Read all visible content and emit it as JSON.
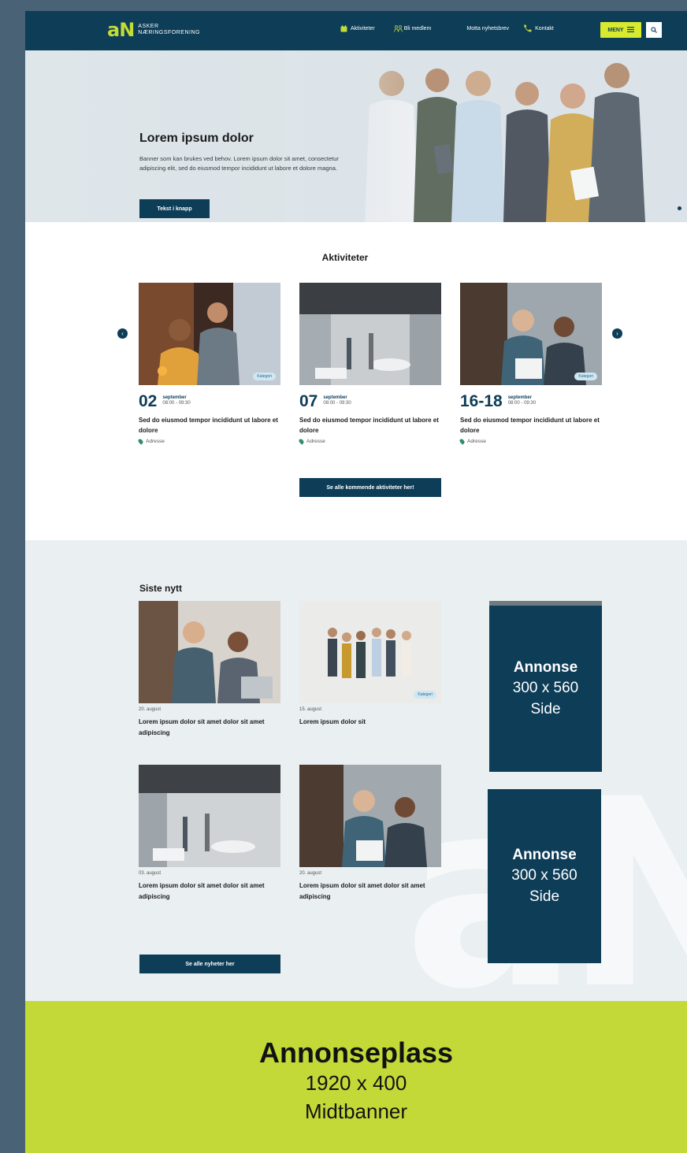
{
  "header": {
    "logo_mark": "aN",
    "logo_line1": "ASKER",
    "logo_line2": "NÆRINGSFORENING",
    "nav": [
      {
        "label": "Aktiviteter",
        "icon": "calendar-icon"
      },
      {
        "label": "Bli medlem",
        "icon": "people-icon"
      },
      {
        "label": "Motta nyhetsbrev",
        "icon": "mail-icon"
      },
      {
        "label": "Kontakt",
        "icon": "phone-icon"
      }
    ],
    "menu_label": "MENY",
    "colors": {
      "bar": "#0d3d57",
      "accent": "#d7ea2d"
    }
  },
  "hero": {
    "title": "Lorem ipsum dolor",
    "text": "Banner som kan brukes ved behov. Lorem ipsum dolor sit amet, consectetur adipiscing elit, sed do eiusmod tempor incididunt ut labore et dolore magna.",
    "button_label": "Tekst i knapp"
  },
  "activities": {
    "title": "Aktiviteter",
    "cards": [
      {
        "day": "02",
        "month": "september",
        "time": "08:00 - 09:30",
        "title": "Sed do eiusmod tempor incididunt ut labore et dolore",
        "address": "Adresse",
        "tag": "Kategori"
      },
      {
        "day": "07",
        "month": "september",
        "time": "08:00 - 09:30",
        "title": "Sed do eiusmod tempor incididunt ut labore et dolore",
        "address": "Adresse",
        "tag": ""
      },
      {
        "day": "16-18",
        "month": "september",
        "time": "08:00 - 09:30",
        "title": "Sed do eiusmod tempor incididunt ut labore et dolore",
        "address": "Adresse",
        "tag": "Kategori"
      }
    ],
    "all_button": "Se alle kommende aktiviteter her!"
  },
  "news": {
    "title": "Siste nytt",
    "items": [
      {
        "date": "20. august",
        "title": "Lorem ipsum dolor sit amet dolor sit amet adipiscing",
        "tag": ""
      },
      {
        "date": "15. august",
        "title": "Lorem ipsum dolor sit",
        "tag": "Kategori"
      },
      {
        "date": "03. august",
        "title": "Lorem ipsum dolor sit amet dolor sit amet adipiscing",
        "tag": ""
      },
      {
        "date": "20. august",
        "title": "Lorem ipsum dolor sit amet dolor sit amet adipiscing",
        "tag": ""
      }
    ],
    "all_button": "Se alle nyheter her",
    "ads": [
      {
        "title": "Annonse",
        "size": "300 x 560",
        "placement": "Side"
      },
      {
        "title": "Annonse",
        "size": "300 x 560",
        "placement": "Side"
      }
    ]
  },
  "midbanner": {
    "title": "Annonseplass",
    "size": "1920 x 400",
    "placement": "Midtbanner",
    "color": "#c2d938"
  }
}
